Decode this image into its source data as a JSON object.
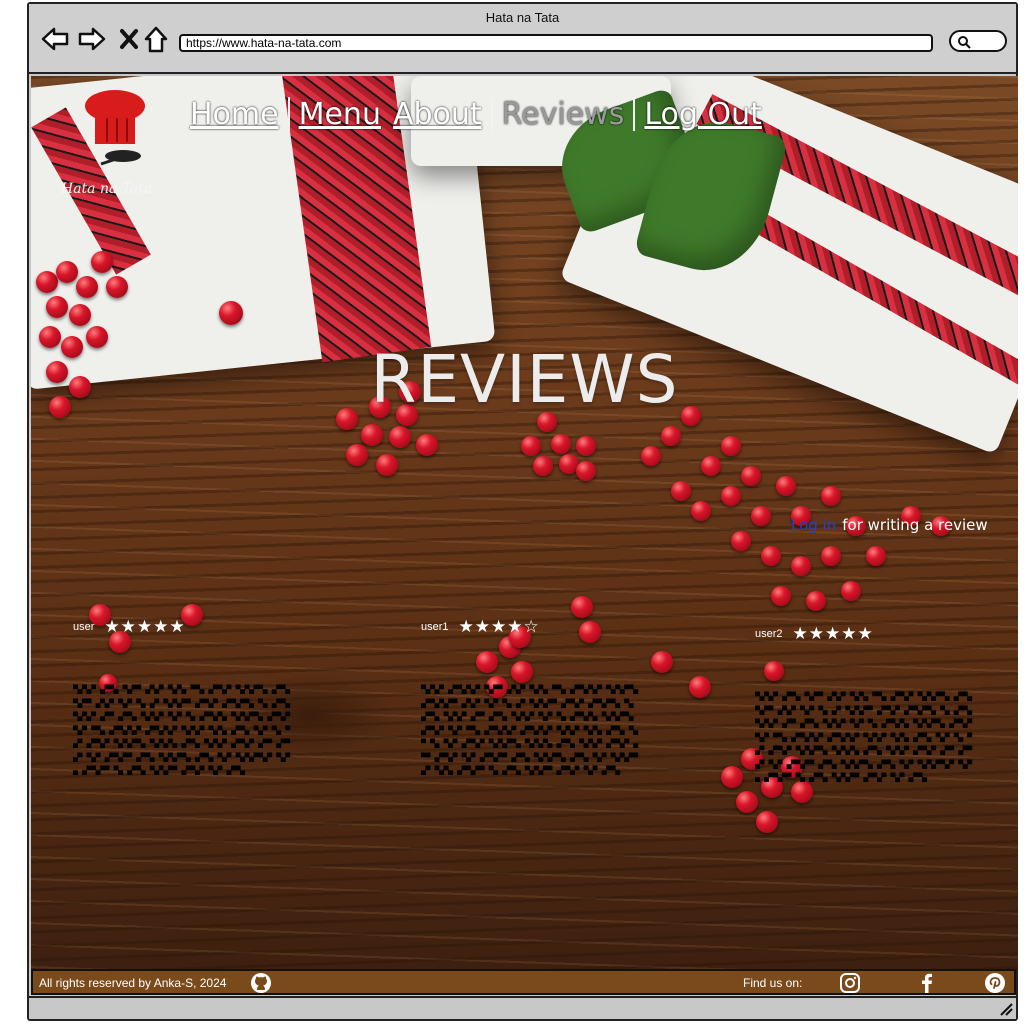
{
  "window": {
    "title": "Hata na Tata",
    "url": "https://www.hata-na-tata.com"
  },
  "nav": {
    "home": "Home",
    "menu": "Menu",
    "about": "About",
    "reviews": "Reviews",
    "logout": "Log Out"
  },
  "logo": {
    "text": "Hata na Tata"
  },
  "page": {
    "title": "REVIEWS",
    "login_link": "Log in",
    "login_suffix": "for writing a review"
  },
  "reviews": [
    {
      "user": "user",
      "stars": "★★★★★",
      "rating": 5
    },
    {
      "user": "user1",
      "stars": "★★★★☆",
      "rating": 4
    },
    {
      "user": "user2",
      "stars": "★★★★★",
      "rating": 5
    }
  ],
  "footer": {
    "copyright": "All rights reserved by Anka-S, 2024",
    "find_us": "Find us on:"
  },
  "icons": {
    "back": "back-arrow-icon",
    "forward": "forward-arrow-icon",
    "close": "close-icon",
    "home": "home-icon",
    "search": "search-icon",
    "github": "github-icon",
    "instagram": "instagram-icon",
    "facebook": "facebook-icon",
    "pinterest": "pinterest-icon"
  }
}
